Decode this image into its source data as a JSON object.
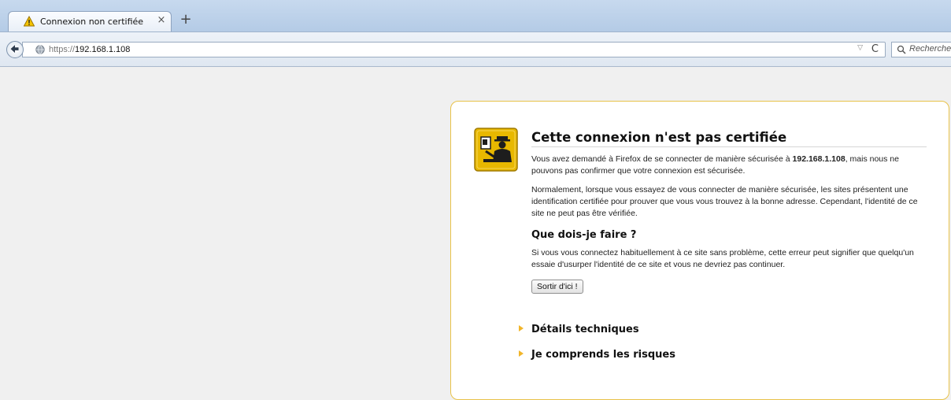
{
  "tab": {
    "title": "Connexion non certifiée",
    "close": "×",
    "new": "+"
  },
  "nav": {
    "url_scheme": "https://",
    "url_host": "192.168.1.108",
    "dropdown": "▽",
    "reload": "C",
    "search_placeholder": "Rechercher"
  },
  "error": {
    "title": "Cette connexion n'est pas certifiée",
    "p1_before": "Vous avez demandé à Firefox de se connecter de manière sécurisée à ",
    "p1_host": "192.168.1.108",
    "p1_after": ", mais nous ne pouvons pas confirmer que votre connexion est sécurisée.",
    "p2": "Normalement, lorsque vous essayez de vous connecter de manière sécurisée, les sites présentent une identification certifiée pour prouver que vous vous trouvez à la bonne adresse. Cependant, l'identité de ce site ne peut pas être vérifiée.",
    "h2": "Que dois-je faire ?",
    "p3": "Si vous vous connectez habituellement à ce site sans problème, cette erreur peut signifier que quelqu'un essaie d'usurper l'identité de ce site et vous ne devriez pas continuer.",
    "exit_button": "Sortir d'ici !",
    "details": "Détails techniques",
    "risks": "Je comprends les risques"
  },
  "colors": {
    "box_border": "#e8c249",
    "badge": "#e8b800",
    "triangle": "#f1b52a"
  },
  "icons": [
    "warning-icon",
    "close-icon",
    "plus-icon",
    "back-arrow-icon",
    "globe-icon",
    "dropdown-icon",
    "reload-icon",
    "search-icon",
    "identity-badge-icon"
  ]
}
